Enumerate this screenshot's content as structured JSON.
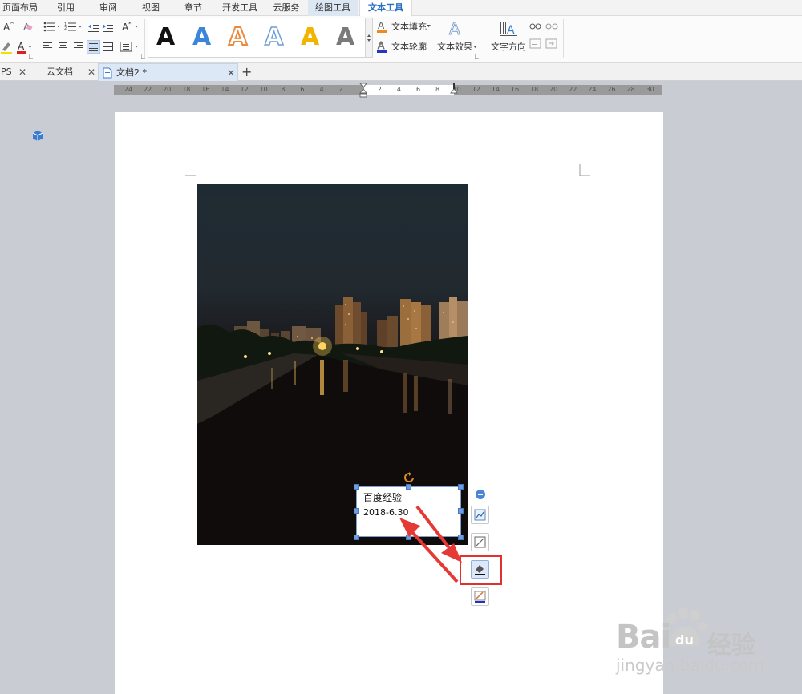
{
  "menu": {
    "tabs": [
      "页面布局",
      "引用",
      "审阅",
      "视图",
      "章节",
      "开发工具",
      "云服务",
      "绘图工具",
      "文本工具"
    ],
    "selected_tab": "绘图工具",
    "active_tab": "文本工具"
  },
  "ribbon": {
    "text_fill_label": "文本填充",
    "text_outline_label": "文本轮廓",
    "text_effect_label": "文本效果",
    "text_direction_label": "文字方向",
    "gallery_letter": "A",
    "gallery_colors": [
      "#111111",
      "#3b86d8",
      "#e98a3e",
      "#6e9ed6",
      "#f2b400",
      "#7a7a7a"
    ]
  },
  "doc_tabs": {
    "partial_label": "PS",
    "cloud_docs_label": "云文档",
    "active_doc_label": "文档2 *",
    "new_tab_label": "+"
  },
  "ruler": {
    "labels": [
      "24",
      "22",
      "20",
      "18",
      "16",
      "14",
      "12",
      "10",
      "8",
      "6",
      "4",
      "2",
      "",
      "2",
      "4",
      "6",
      "8",
      "10",
      "12",
      "14",
      "16",
      "18",
      "20",
      "22",
      "24",
      "26",
      "28",
      "30"
    ]
  },
  "textbox": {
    "line1": "百度经验",
    "line2": "2018-6.30"
  },
  "watermark": {
    "brand": "Bai",
    "brand_tail": "du",
    "brand_cn": "经验",
    "url": "jingyan.baidu.com"
  }
}
